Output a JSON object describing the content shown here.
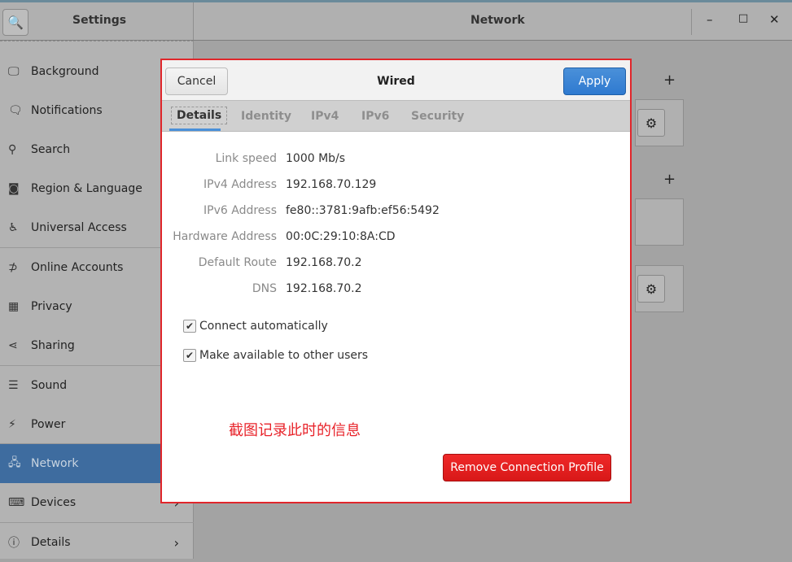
{
  "header": {
    "left_title": "Settings",
    "right_title": "Network"
  },
  "window_controls": {
    "minimize": "–",
    "maximize": "□",
    "close": "✕"
  },
  "sidebar": {
    "items": [
      {
        "label": "Background",
        "icon": "🖵"
      },
      {
        "label": "Notifications",
        "icon": "🗨"
      },
      {
        "label": "Search",
        "icon": "⚲"
      },
      {
        "label": "Region & Language",
        "icon": "◙"
      },
      {
        "label": "Universal Access",
        "icon": "♿"
      },
      {
        "label": "Online Accounts",
        "icon": "⊅"
      },
      {
        "label": "Privacy",
        "icon": "▦"
      },
      {
        "label": "Sharing",
        "icon": "⋖"
      },
      {
        "label": "Sound",
        "icon": "☰"
      },
      {
        "label": "Power",
        "icon": "⚡"
      },
      {
        "label": "Network",
        "icon": "🖧"
      },
      {
        "label": "Devices",
        "icon": "⌨"
      },
      {
        "label": "Details",
        "icon": "ⓘ"
      }
    ],
    "selected": "Network"
  },
  "dialog": {
    "title": "Wired",
    "cancel": "Cancel",
    "apply": "Apply",
    "tabs": [
      "Details",
      "Identity",
      "IPv4",
      "IPv6",
      "Security"
    ],
    "active_tab": "Details",
    "details": [
      {
        "label": "Link speed",
        "value": "1000 Mb/s"
      },
      {
        "label": "IPv4 Address",
        "value": "192.168.70.129"
      },
      {
        "label": "IPv6 Address",
        "value": "fe80::3781:9afb:ef56:5492"
      },
      {
        "label": "Hardware Address",
        "value": "00:0C:29:10:8A:CD"
      },
      {
        "label": "Default Route",
        "value": "192.168.70.2"
      },
      {
        "label": "DNS",
        "value": "192.168.70.2"
      }
    ],
    "checkboxes": [
      {
        "label": "Connect automatically",
        "checked": true
      },
      {
        "label": "Make available to other users",
        "checked": true
      }
    ],
    "annotation": "截图记录此时的信息",
    "remove": "Remove Connection Profile"
  },
  "colors": {
    "accent": "#4a90d9",
    "danger": "#e0262b",
    "selected": "#3e6c9f"
  }
}
